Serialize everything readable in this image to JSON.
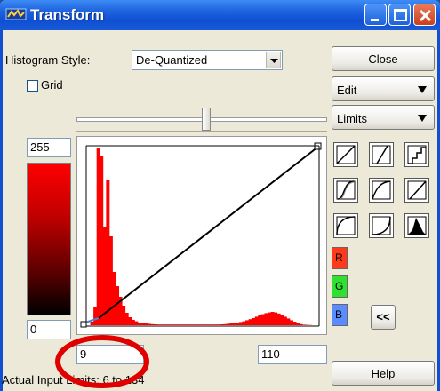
{
  "window": {
    "title": "Transform",
    "accent": "#0f4fd2"
  },
  "toolbar": {
    "histogram_style_label": "Histogram Style:",
    "histogram_style_value": "De-Quantized",
    "grid_label": "Grid",
    "grid_checked": false
  },
  "buttons": {
    "close": "Close",
    "edit": "Edit",
    "limits": "Limits",
    "collapse": "<<",
    "help": "Help"
  },
  "channels": {
    "r": "R",
    "g": "G",
    "b": "B"
  },
  "output_range": {
    "max": "255",
    "min": "0"
  },
  "input_limits": {
    "low": "9",
    "high": "110",
    "actual_label": "Actual Input Limits: 6 to 134"
  },
  "slider": {
    "position": 0.52
  },
  "histogram": {
    "color": "#ff0000",
    "bins": [
      0,
      0.02,
      0.1,
      1.0,
      0.95,
      0.55,
      0.82,
      0.5,
      0.3,
      0.22,
      0.16,
      0.11,
      0.07,
      0.045,
      0.03,
      0.022,
      0.015,
      0.012,
      0.01,
      0.008,
      0.006,
      0.005,
      0.004,
      0.004,
      0.004,
      0.004,
      0.004,
      0.004,
      0.004,
      0.004,
      0.004,
      0.004,
      0.004,
      0.004,
      0.004,
      0.004,
      0.004,
      0.004,
      0.004,
      0.004,
      0.004,
      0.004,
      0.005,
      0.006,
      0.008,
      0.01,
      0.012,
      0.014,
      0.018,
      0.022,
      0.028,
      0.034,
      0.04,
      0.048,
      0.055,
      0.062,
      0.068,
      0.072,
      0.075,
      0.072,
      0.066,
      0.058,
      0.048,
      0.038,
      0.028,
      0.02,
      0.012,
      0.006,
      0.003,
      0.002,
      0.001,
      0,
      0
    ]
  },
  "annotation": {
    "color": "#e00000"
  }
}
